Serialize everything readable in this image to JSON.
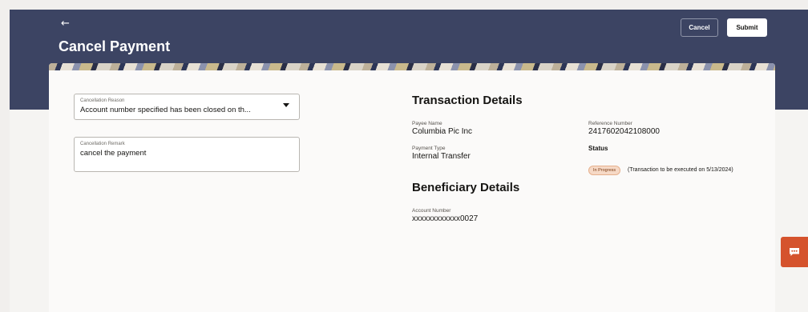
{
  "header": {
    "title": "Cancel Payment",
    "cancel_label": "Cancel",
    "submit_label": "Submit"
  },
  "form": {
    "reason": {
      "label": "Cancellation Reason",
      "value": "Account number specified has been closed on th..."
    },
    "remark": {
      "label": "Cancellation Remark",
      "value": "cancel the payment"
    }
  },
  "transaction": {
    "title": "Transaction Details",
    "payee_name_label": "Payee Name",
    "payee_name": "Columbia Pic Inc",
    "reference_label": "Reference Number",
    "reference": "2417602042108000",
    "payment_type_label": "Payment Type",
    "payment_type": "Internal Transfer",
    "status_label": "Status",
    "status_badge": "In Progress",
    "status_note": "(Transaction to be executed on 5/13/2024)"
  },
  "beneficiary": {
    "title": "Beneficiary Details",
    "account_label": "Account Number",
    "account": "xxxxxxxxxxxx0027"
  },
  "colors": {
    "header_bg": "#3c4463",
    "accent": "#d5532d",
    "badge_bg": "#f6d9c6"
  },
  "icons": {
    "back": "back-arrow-icon",
    "dropdown": "chevron-down-icon",
    "chat": "chat-icon"
  }
}
